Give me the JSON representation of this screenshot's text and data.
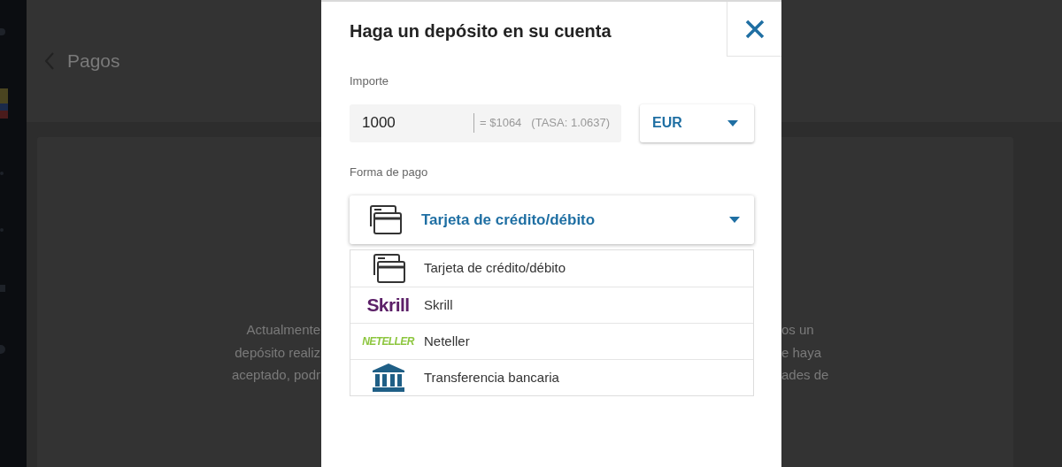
{
  "page": {
    "back_label": "Pagos",
    "notice_left": [
      "Actualmente",
      "depósito realiz",
      "aceptado, podr"
    ],
    "notice_right": [
      "os un",
      "e haya",
      "ades de"
    ]
  },
  "dialog": {
    "title": "Haga un depósito en su cuenta",
    "amount": {
      "label": "Importe",
      "value": "1000",
      "conversion": "= $1064",
      "rate": "(TASA: 1.0637)"
    },
    "currency": {
      "value": "EUR"
    },
    "payment": {
      "label": "Forma de pago",
      "value": "Tarjeta de crédito/débito",
      "expanded": true,
      "options": [
        {
          "kind": "card",
          "label": "Tarjeta de crédito/débito"
        },
        {
          "kind": "skrill",
          "logo": "Skrill",
          "label": "Skrill"
        },
        {
          "kind": "neteller",
          "logo": "NETELLER",
          "label": "Neteller"
        },
        {
          "kind": "bank",
          "label": "Transferencia bancaria"
        }
      ]
    }
  }
}
